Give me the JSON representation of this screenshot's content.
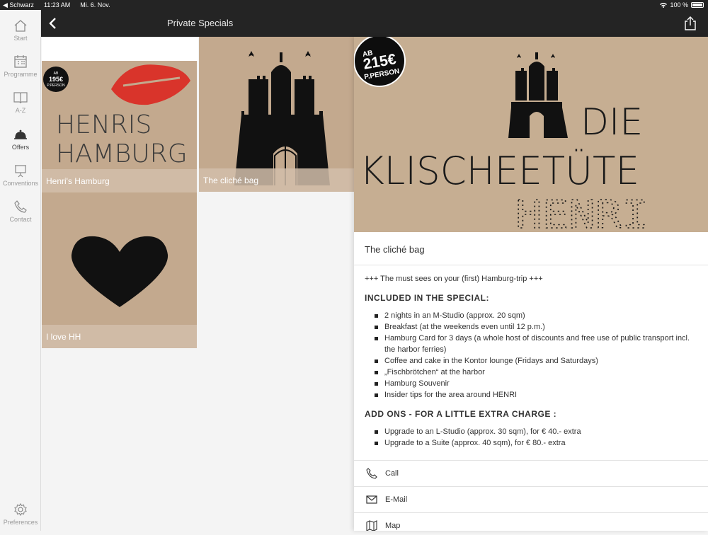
{
  "status": {
    "carrier": "◀ Schwarz",
    "time": "11:23 AM",
    "date": "Mi. 6. Nov.",
    "battery": "100 %"
  },
  "nav": {
    "title": "Private Specials"
  },
  "sidebar": {
    "items": [
      {
        "label": "Start",
        "icon": "home-icon"
      },
      {
        "label": "Programme",
        "icon": "calendar-icon"
      },
      {
        "label": "A-Z",
        "icon": "book-icon"
      },
      {
        "label": "Offers",
        "icon": "service-bell-icon"
      },
      {
        "label": "Conventions",
        "icon": "presentation-icon"
      },
      {
        "label": "Contact",
        "icon": "phone-icon"
      }
    ],
    "preferences": "Preferences"
  },
  "tiles": [
    {
      "caption": "Henri's Hamburg",
      "art_line1": "HENRIS",
      "art_line2": "HAMBURG",
      "badge_top": "AB",
      "badge_price": "195€",
      "badge_bottom": "P.PERSON"
    },
    {
      "caption": "The cliché bag"
    },
    {
      "caption": "I love HH"
    }
  ],
  "detail": {
    "hero": {
      "badge_top": "AB",
      "badge_price": "215€",
      "badge_bottom": "P.PERSON",
      "line1": "DIE",
      "line2": "KLISCHEETÜTE",
      "line3": "HENRI"
    },
    "title": "The cliché bag",
    "tagline": "+++ The must sees on your (first) Hamburg-trip +++",
    "included_heading": "INCLUDED IN THE SPECIAL:",
    "included": [
      "2 nights in an M-Studio (approx. 20 sqm)",
      "Breakfast (at the weekends even until 12 p.m.)",
      "Hamburg Card for 3 days (a whole host of discounts and free use of public transport incl. the harbor ferries)",
      "Coffee and cake in the Kontor lounge (Fridays and Saturdays)",
      "„Fischbrötchen“ at the harbor",
      "Hamburg Souvenir",
      "Insider tips for the area around HENRI"
    ],
    "addons_heading": "ADD ONS - FOR A LITTLE EXTRA CHARGE :",
    "addons": [
      "Upgrade to an L-Studio (approx. 30 sqm), for € 40.- extra",
      "Upgrade to a Suite (approx. 40 sqm), for € 80.- extra"
    ],
    "actions": [
      {
        "label": "Call",
        "icon": "phone-icon"
      },
      {
        "label": "E-Mail",
        "icon": "envelope-icon"
      },
      {
        "label": "Map",
        "icon": "map-icon"
      }
    ]
  }
}
